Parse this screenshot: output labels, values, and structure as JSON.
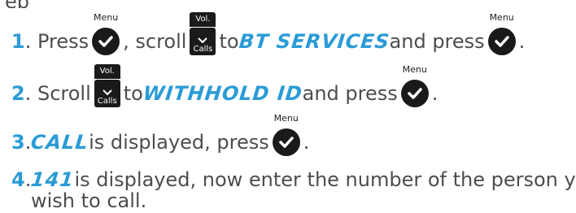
{
  "intro_fragment": "ep",
  "icons": {
    "menu_label": "Menu",
    "vol_label": "Vol.",
    "calls_label": "Calls"
  },
  "steps": [
    {
      "number": "1",
      "parts": {
        "a": ". Press ",
        "b": ", scroll ",
        "c": " to ",
        "d": "BT SERVICES",
        "e": " and press ",
        "f": "."
      }
    },
    {
      "number": "2",
      "parts": {
        "a": ". Scroll ",
        "b": " to ",
        "c": "WITHHOLD ID",
        "d": " and press ",
        "e": "."
      }
    },
    {
      "number": "3",
      "parts": {
        "a": ". ",
        "b": "CALL",
        "c": " is displayed, press ",
        "d": "."
      }
    },
    {
      "number": "4",
      "parts": {
        "a": ". ",
        "b": "141",
        "c": " is displayed, now enter the number of the person you",
        "d": "wish to call."
      }
    }
  ]
}
